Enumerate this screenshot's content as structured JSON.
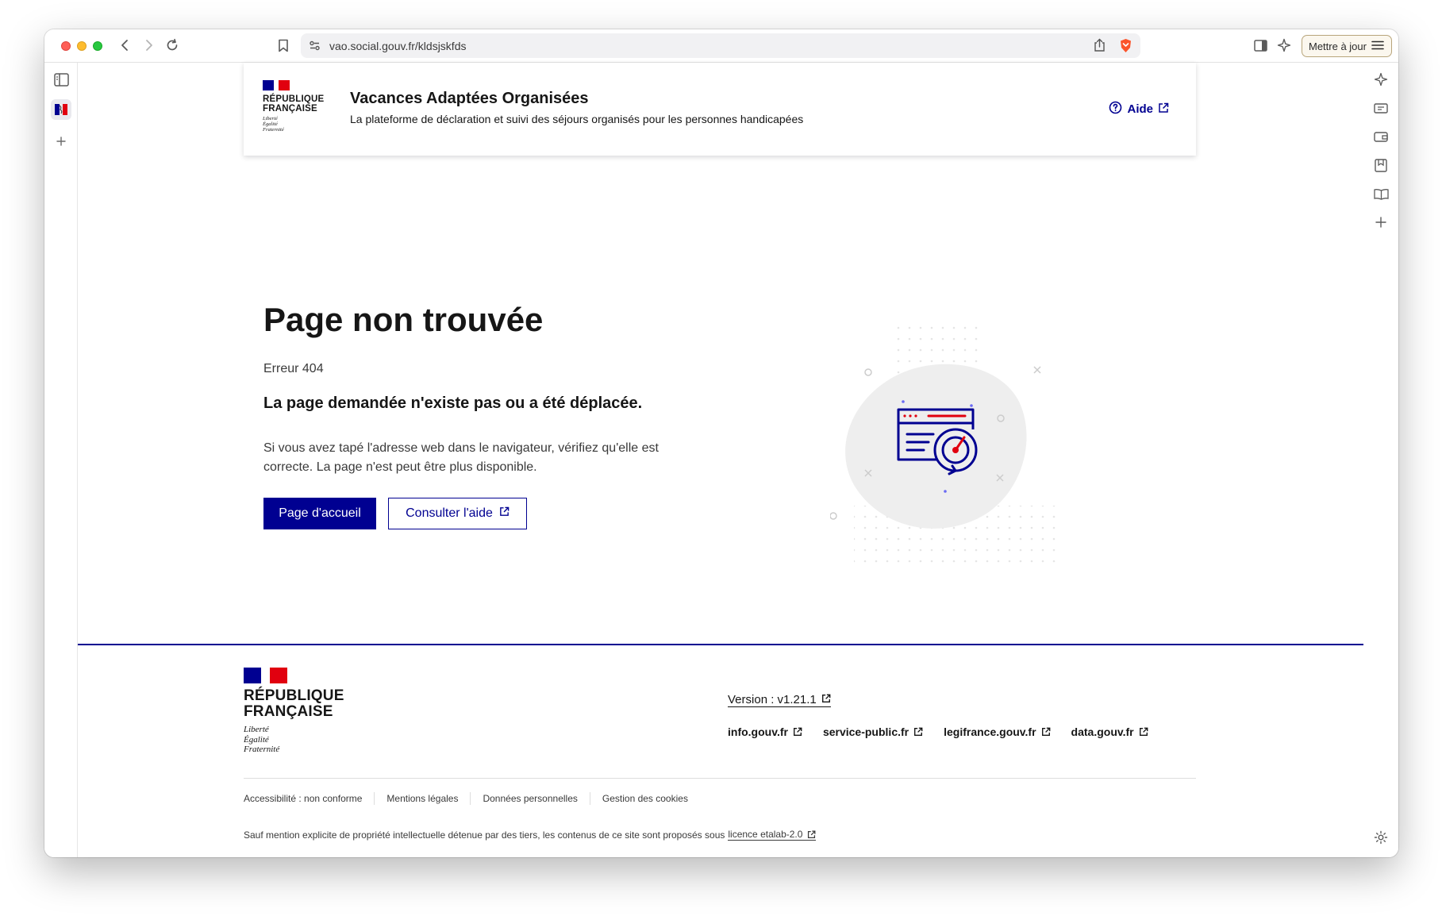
{
  "browser": {
    "url": "vao.social.gouv.fr/kldsjskfds",
    "update_button": "Mettre à jour"
  },
  "header": {
    "logo_rf": "RÉPUBLIQUE FRANÇAISE",
    "logo_rf_line1": "RÉPUBLIQUE",
    "logo_rf_line2": "FRANÇAISE",
    "devise1": "Liberté",
    "devise2": "Égalité",
    "devise3": "Fraternité",
    "service_title": "Vacances Adaptées Organisées",
    "service_tagline": "La plateforme de déclaration et suivi des séjours organisés pour les personnes handicapées",
    "help_link": "Aide"
  },
  "main": {
    "title": "Page non trouvée",
    "error_code": "Erreur 404",
    "lead": "La page demandée n'existe pas ou a été déplacée.",
    "description": "Si vous avez tapé l'adresse web dans le navigateur, vérifiez qu'elle est correcte. La page n'est peut être plus disponible.",
    "home_button": "Page d'accueil",
    "help_button": "Consulter l'aide"
  },
  "footer": {
    "version": "Version : v1.21.1",
    "gov_links": [
      "info.gouv.fr",
      "service-public.fr",
      "legifrance.gouv.fr",
      "data.gouv.fr"
    ],
    "bottom_links": [
      "Accessibilité : non conforme",
      "Mentions légales",
      "Données personnelles",
      "Gestion des cookies"
    ],
    "license_text": "Sauf mention explicite de propriété intellectuelle détenue par des tiers, les contenus de ce site sont proposés sous",
    "license_link": "licence etalab-2.0"
  },
  "colors": {
    "brand_blue": "#000091",
    "brand_red": "#e1000f"
  }
}
